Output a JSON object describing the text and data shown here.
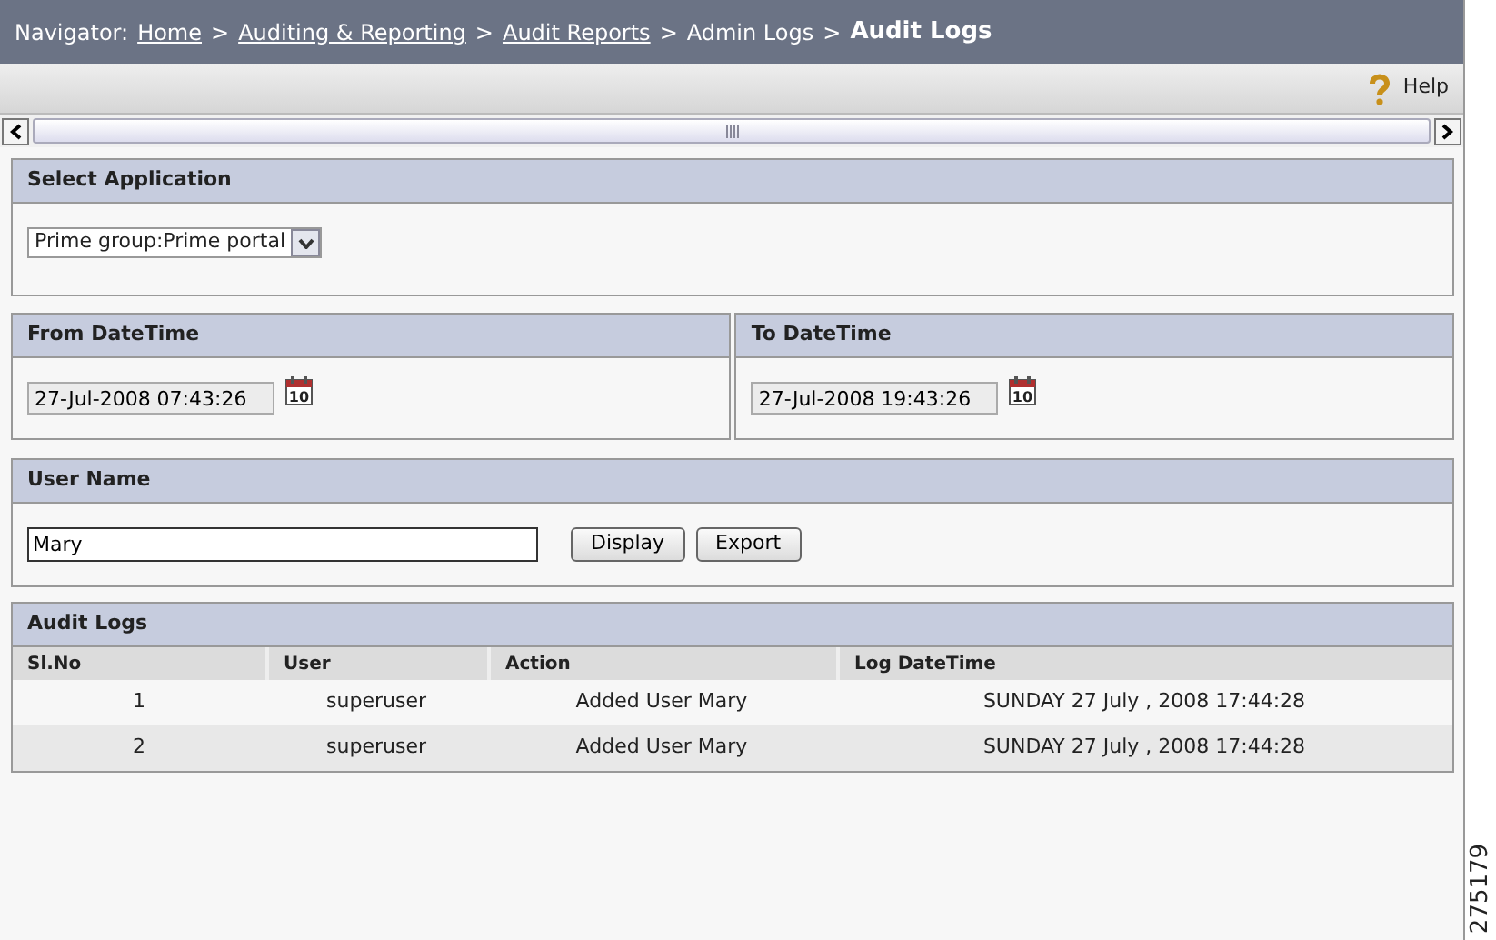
{
  "navigator": {
    "label": "Navigator:",
    "separator": ">",
    "crumbs": [
      {
        "text": "Home",
        "kind": "link"
      },
      {
        "text": "Auditing & Reporting",
        "kind": "link"
      },
      {
        "text": "Audit Reports",
        "kind": "link"
      },
      {
        "text": "Admin Logs",
        "kind": "plain"
      },
      {
        "text": "Audit Logs",
        "kind": "current"
      }
    ]
  },
  "toolbar": {
    "help": "Help"
  },
  "select_application": {
    "title": "Select Application",
    "value": "Prime group:Prime portal"
  },
  "from_datetime": {
    "title": "From DateTime",
    "value": "27-Jul-2008 07:43:26",
    "calendar_day": "10"
  },
  "to_datetime": {
    "title": "To DateTime",
    "value": "27-Jul-2008 19:43:26",
    "calendar_day": "10"
  },
  "user_name": {
    "title": "User Name",
    "value": "Mary",
    "buttons": [
      "Display",
      "Export"
    ]
  },
  "audit_logs": {
    "title": "Audit Logs",
    "columns": [
      "Sl.No",
      "User",
      "Action",
      "Log DateTime"
    ],
    "rows": [
      [
        "1",
        "superuser",
        "Added User Mary",
        "SUNDAY 27 July , 2008 17:44:28"
      ],
      [
        "2",
        "superuser",
        "Added User Mary",
        "SUNDAY 27 July , 2008 17:44:28"
      ]
    ]
  },
  "figure_number": "275179"
}
